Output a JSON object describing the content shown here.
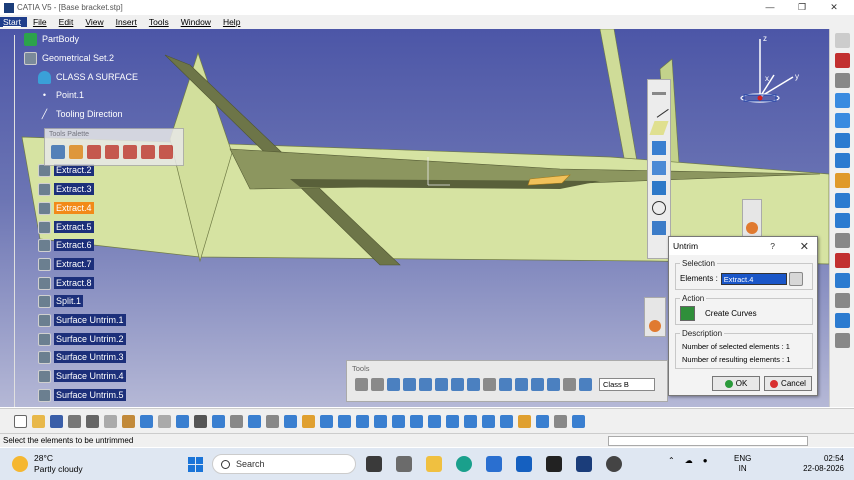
{
  "window": {
    "title": "CATIA V5 - [Base bracket.stp]",
    "buttons": [
      "—",
      "❐",
      "✕"
    ]
  },
  "menu": [
    "Start",
    "File",
    "Edit",
    "View",
    "Insert",
    "Tools",
    "Window",
    "Help"
  ],
  "tree": [
    {
      "label": "PartBody",
      "icon": "partbody-icon"
    },
    {
      "label": "Geometrical Set.2",
      "icon": "geometrical-set-icon"
    },
    {
      "label": "CLASS A SURFACE",
      "icon": "surface-icon"
    },
    {
      "label": "Point.1",
      "icon": "point-icon"
    },
    {
      "label": "Tooling Direction",
      "icon": "line-icon"
    },
    {
      "label": "Extract.2",
      "icon": "extract-icon"
    },
    {
      "label": "Extract.3",
      "icon": "extract-icon"
    },
    {
      "label": "Extract.4",
      "icon": "extract-icon",
      "highlighted": true
    },
    {
      "label": "Extract.5",
      "icon": "extract-icon"
    },
    {
      "label": "Extract.6",
      "icon": "extract-icon"
    },
    {
      "label": "Extract.7",
      "icon": "extract-icon"
    },
    {
      "label": "Extract.8",
      "icon": "extract-icon"
    },
    {
      "label": "Split.1",
      "icon": "split-icon"
    },
    {
      "label": "Surface Untrim.1",
      "icon": "untrim-icon"
    },
    {
      "label": "Surface Untrim.2",
      "icon": "untrim-icon"
    },
    {
      "label": "Surface Untrim.3",
      "icon": "untrim-icon"
    },
    {
      "label": "Surface Untrim.4",
      "icon": "untrim-icon"
    },
    {
      "label": "Surface Untrim.5",
      "icon": "untrim-icon"
    }
  ],
  "tools_palette": {
    "title": "Tools Palette"
  },
  "dialog": {
    "title": "Untrim",
    "help": "?",
    "close": "✕",
    "selection_legend": "Selection",
    "elements_label": "Elements :",
    "elements_value": "Extract.4",
    "action_legend": "Action",
    "create_curves": "Create Curves",
    "description_legend": "Description",
    "selected_count": "Number of selected elements : 1",
    "resulting_count": "Number of resulting elements : 1",
    "ok": "OK",
    "cancel": "Cancel"
  },
  "tools_bar": {
    "title": "Tools",
    "class_value": "Class B"
  },
  "compass": {
    "z": "z",
    "x": "x",
    "y": "y"
  },
  "status": {
    "message": "Select the elements to be untrimmed"
  },
  "taskbar": {
    "temperature": "28°C",
    "weather": "Partly cloudy",
    "search": "Search",
    "lang1": "ENG",
    "lang2": "IN",
    "time": "02:54",
    "date": "22-08-2026"
  },
  "colors": {
    "surface": "#d6e3a2",
    "selection_bg": "#1c2f7a",
    "highlight": "#f28a18",
    "viewport_top": "#4c56a7"
  }
}
